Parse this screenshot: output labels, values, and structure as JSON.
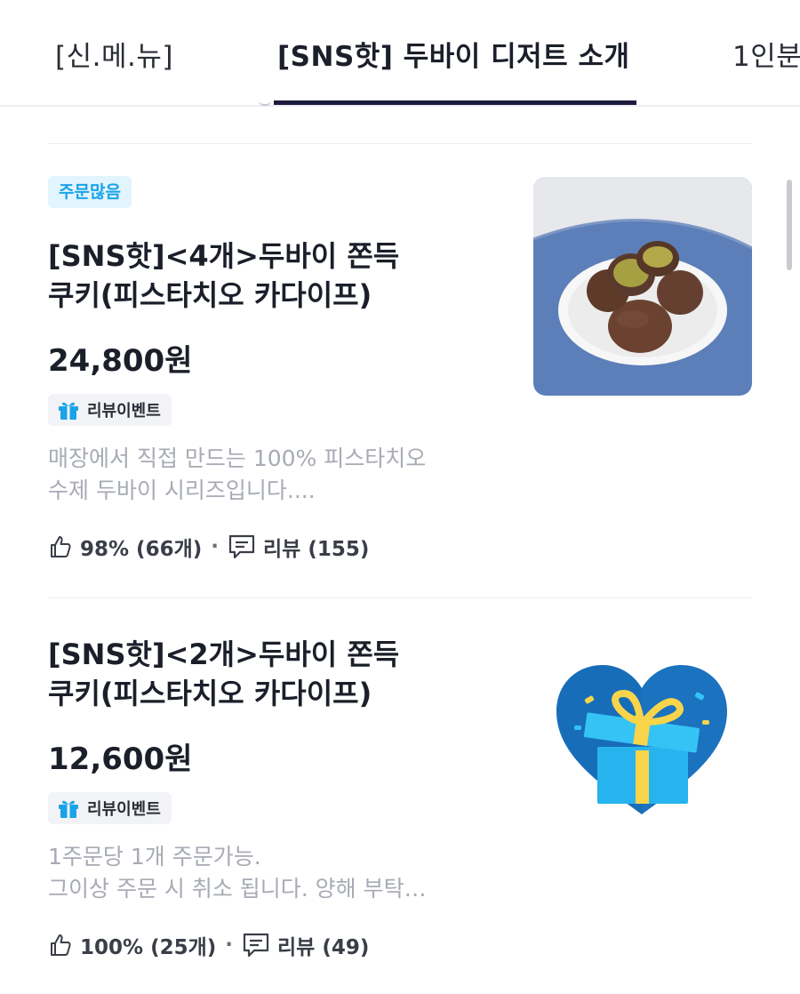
{
  "tabs": [
    {
      "label": "[신.메.뉴]",
      "active": false
    },
    {
      "label": "[SNS핫] 두바이 디저트 소개",
      "active": true
    },
    {
      "label": "1인분",
      "active": false
    }
  ],
  "items": [
    {
      "badge": "주문많음",
      "title_line1": "[SNS핫]<4개>두바이 쫀득",
      "title_line2": "쿠키(피스타치오 카다이프)",
      "price": "24,800원",
      "event": "리뷰이벤트",
      "desc_line1": "매장에서 직접 만드는 100% 피스타치오",
      "desc_line2": "수제 두바이 시리즈입니다....",
      "rating": "98% (66개)",
      "reviews": "리뷰 (155)",
      "image": "dubai-cookie-photo"
    },
    {
      "title_line1": "[SNS핫]<2개>두바이 쫀득",
      "title_line2": "쿠키(피스타치오 카다이프)",
      "price": "12,600원",
      "event": "리뷰이벤트",
      "desc_line1": "1주문당 1개 주문가능.",
      "desc_line2": "그이상 주문 시 취소 됩니다. 양해 부탁…",
      "rating": "100% (25개)",
      "reviews": "리뷰 (49)",
      "image": "gift-heart-icon"
    }
  ],
  "colors": {
    "accent_tab": "#1c1a3e",
    "badge_bg": "#e2f4fd",
    "badge_text": "#1aa3e8",
    "desc_text": "#a7abb4"
  }
}
